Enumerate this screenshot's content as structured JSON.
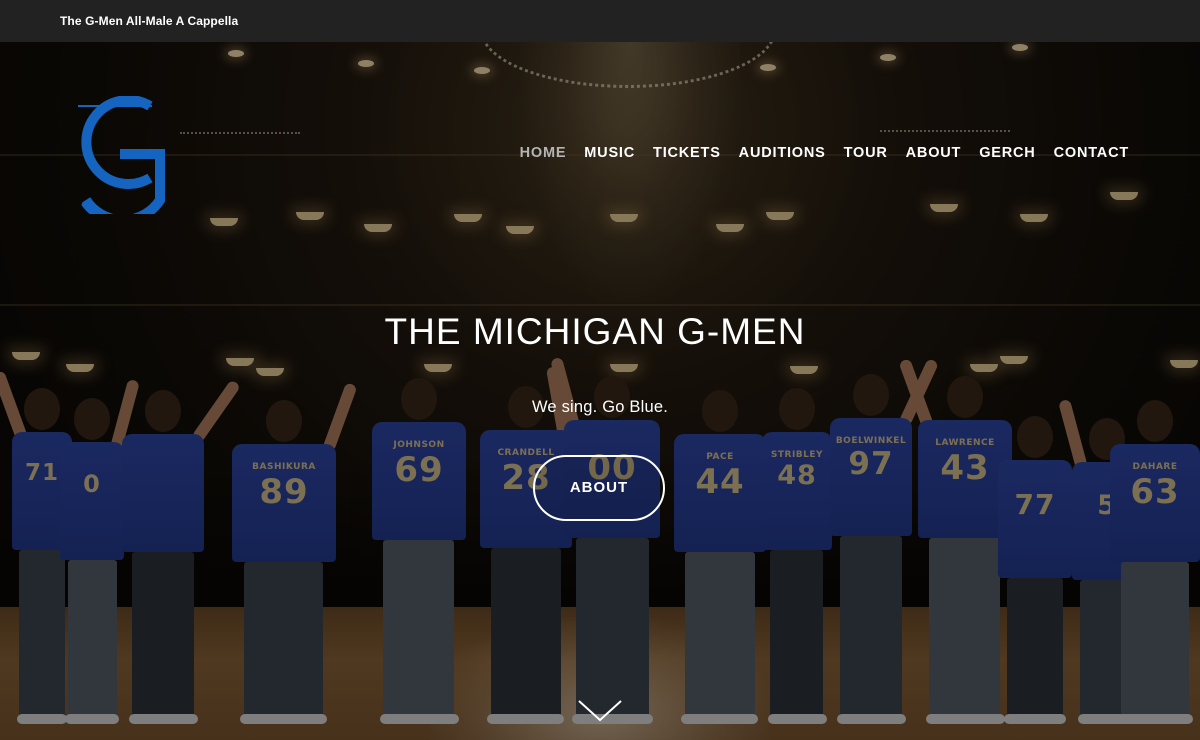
{
  "topbar": {
    "site_name": "The G-Men All-Male A Cappella"
  },
  "logo": {
    "letter": "G",
    "color": "#1565c0",
    "icon": "g-monogram-logo"
  },
  "nav": {
    "items": [
      {
        "label": "HOME",
        "active": true
      },
      {
        "label": "MUSIC",
        "active": false
      },
      {
        "label": "TICKETS",
        "active": false
      },
      {
        "label": "AUDITIONS",
        "active": false
      },
      {
        "label": "TOUR",
        "active": false
      },
      {
        "label": "ABOUT",
        "active": false
      },
      {
        "label": "GERCH",
        "active": false
      },
      {
        "label": "CONTACT",
        "active": false
      }
    ],
    "active_color": "#b4b4b4",
    "color": "#ffffff"
  },
  "hero": {
    "title": "THE MICHIGAN G-MEN",
    "subtitle": "We sing. Go Blue.",
    "button_label": "ABOUT",
    "scroll_icon": "chevron-down-icon"
  },
  "singers": [
    {
      "name": "",
      "number": "71"
    },
    {
      "name": "",
      "number": "0"
    },
    {
      "name": "",
      "number": ""
    },
    {
      "name": "BASHIKURA",
      "number": "89"
    },
    {
      "name": "JOHNSON",
      "number": "69"
    },
    {
      "name": "CRANDELL",
      "number": "28"
    },
    {
      "name": "",
      "number": "00"
    },
    {
      "name": "PACE",
      "number": "44"
    },
    {
      "name": "STRIBLEY",
      "number": "48"
    },
    {
      "name": "BOELWINKEL",
      "number": "97"
    },
    {
      "name": "LAWRENCE",
      "number": "43"
    },
    {
      "name": "",
      "number": "77"
    },
    {
      "name": "",
      "number": "5"
    },
    {
      "name": "DAHARE",
      "number": "63"
    }
  ]
}
